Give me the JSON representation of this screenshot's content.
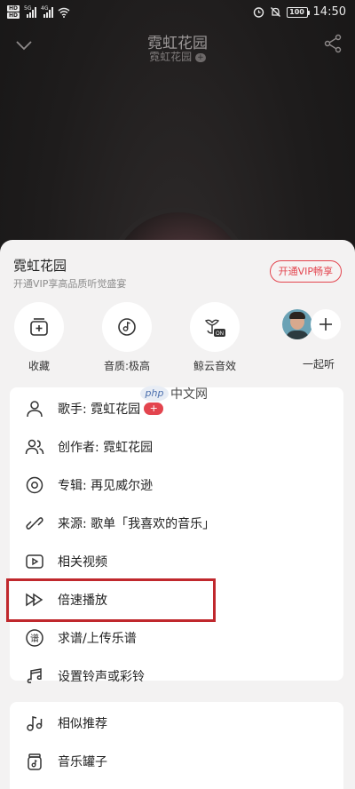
{
  "status_bar": {
    "hd1": "HD",
    "hd2": "HD",
    "sig1_label": "5G",
    "sig2_label": "4G",
    "battery": "100",
    "time": "14:50"
  },
  "player": {
    "title": "霓虹花园",
    "artist": "霓虹花园",
    "artist_badge": "+"
  },
  "sheet": {
    "title": "霓虹花园",
    "subtitle": "开通VIP享高品质听觉盛宴",
    "vip_button": "开通VIP畅享",
    "actions": [
      {
        "label": "收藏",
        "icon": "add-to-playlist-icon"
      },
      {
        "label": "音质:极高",
        "icon": "disc-note-icon"
      },
      {
        "label": "鲸云音效",
        "icon": "whale-sound-effect-icon",
        "badge": "ON"
      },
      {
        "label": "一起听",
        "icon": "plus-icon"
      }
    ],
    "menu": [
      {
        "label": "歌手: 霓虹花园",
        "icon": "person-icon",
        "badge": "+"
      },
      {
        "label": "创作者: 霓虹花园",
        "icon": "creators-icon"
      },
      {
        "label": "专辑: 再见威尔逊",
        "icon": "album-disc-icon"
      },
      {
        "label": "来源: 歌单「我喜欢的音乐」",
        "icon": "link-icon"
      },
      {
        "label": "相关视频",
        "icon": "video-icon"
      },
      {
        "label": "倍速播放",
        "icon": "double-speed-icon"
      },
      {
        "label": "求谱/上传乐谱",
        "icon": "sheet-music-icon",
        "glyph": "谱"
      },
      {
        "label": "设置铃声或彩铃",
        "icon": "ringtone-icon"
      },
      {
        "label": "相似推荐",
        "icon": "similar-music-icon"
      },
      {
        "label": "音乐罐子",
        "icon": "music-jar-icon"
      }
    ]
  },
  "watermark": {
    "logo": "php",
    "text": "中文网"
  },
  "colors": {
    "accent": "#e3444e",
    "highlight": "#c0282d",
    "sheet_bg": "#f3f2f2"
  }
}
